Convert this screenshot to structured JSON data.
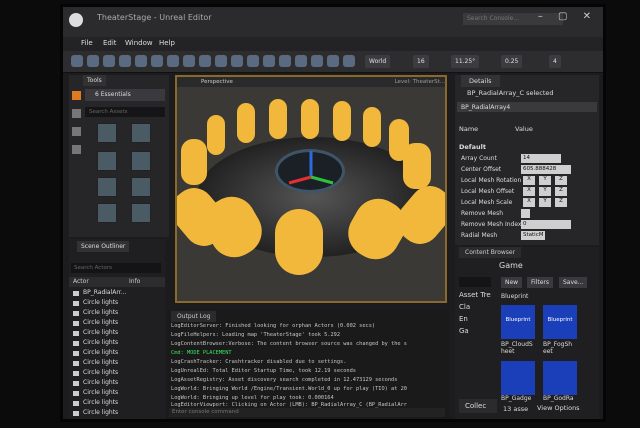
{
  "window": {
    "title": "TheaterStage - Unreal Editor",
    "search_placeholder": "Search Console..."
  },
  "menu": [
    "File",
    "Edit",
    "Window",
    "Help"
  ],
  "toolbar": {
    "world": "World",
    "snap_grid": "16",
    "snap_angle": "11.25°",
    "snap_scale": "0.25",
    "camera_speed": "4"
  },
  "tools": {
    "tab_label": "Tools",
    "mode": "6 Essentials",
    "search_placeholder": "Search Assets"
  },
  "scene_outliner": {
    "tab_label": "Scene Outliner",
    "search_placeholder": "Search Actors",
    "columns": [
      "Actor",
      "Info"
    ],
    "rows": [
      "BP_RadialArr...",
      "Circle lights",
      "Circle lights",
      "Circle lights",
      "Circle lights",
      "Circle lights",
      "Circle lights",
      "Circle lights",
      "Circle lights",
      "Circle lights",
      "Circle lights",
      "Circle lights",
      "Circle lights"
    ]
  },
  "viewport": {
    "view_mode": "Perspective",
    "level_label": "Level: TheaterSt..."
  },
  "output_log": {
    "tab_label": "Output Log",
    "lines": [
      "LogEditorServer: Finished looking for orphan Actors (0.002 secs)",
      "LogFileHelpers: Loading map 'TheaterStage' took 5.292",
      "LogContentBrowser:Verbose: The content browser source was changed by the s",
      "Cmd: MODE PLACEMENT",
      "LogCrashTracker: Crashtracker disabled due to settings.",
      "LogUnrealEd: Total Editor Startup Time, took 12.19 seconds",
      "LogAssetRegistry: Asset discovery search completed in 12.473129 seconds",
      "LogWorld: Bringing World /Engine/Transient.World_0 up for play (TIO) at 20",
      "LogWorld: Bringing up level for play took: 0.000164",
      "LogEditorViewport: Clicking on Actor (LMB): BP_RadialArray_C (BP_RadialArr"
    ],
    "command_placeholder": "Enter console command"
  },
  "details": {
    "tab_label": "Details",
    "selected": "BP_RadialArray_C selected",
    "object_name": "BP_RadialArray4",
    "columns": [
      "Name",
      "Value"
    ],
    "category": "Default",
    "properties": [
      {
        "name": "Array Count",
        "value": "14"
      },
      {
        "name": "Center Offset",
        "value": "605.888428"
      },
      {
        "name": "Local Mesh Rotation",
        "value": "X Y Z"
      },
      {
        "name": "Local Mesh Offset",
        "value": "X Y Z"
      },
      {
        "name": "Local Mesh Scale",
        "value": "X Y Z"
      },
      {
        "name": "Remove Mesh",
        "value": ""
      },
      {
        "name": "Remove Mesh Index",
        "value": "0"
      },
      {
        "name": "Radial Mesh",
        "value": "StaticM"
      }
    ]
  },
  "content_browser": {
    "tab_label": "Content Browser",
    "path": "Game",
    "buttons": [
      "New",
      "Filters",
      "Save..."
    ],
    "tree_label": "Asset Tre",
    "tree_items": [
      "Cla",
      "En",
      "Ga"
    ],
    "filter_chip": "Blueprint",
    "tiles": [
      {
        "label": "Blueprint",
        "caption": "BP_CloudS heet"
      },
      {
        "label": "Blueprint",
        "caption": "BP_FogSh eet"
      },
      {
        "label": "",
        "caption": "BP_Gadge"
      },
      {
        "label": "",
        "caption": "BP_GodRa"
      }
    ],
    "collections": "Collec",
    "item_count": "13 asse",
    "view_options": "View Options"
  },
  "colors": {
    "accent_gold": "#f2b83b",
    "blueprint_blue": "#1a3fb8",
    "selection_orange": "#8a6a2a"
  }
}
